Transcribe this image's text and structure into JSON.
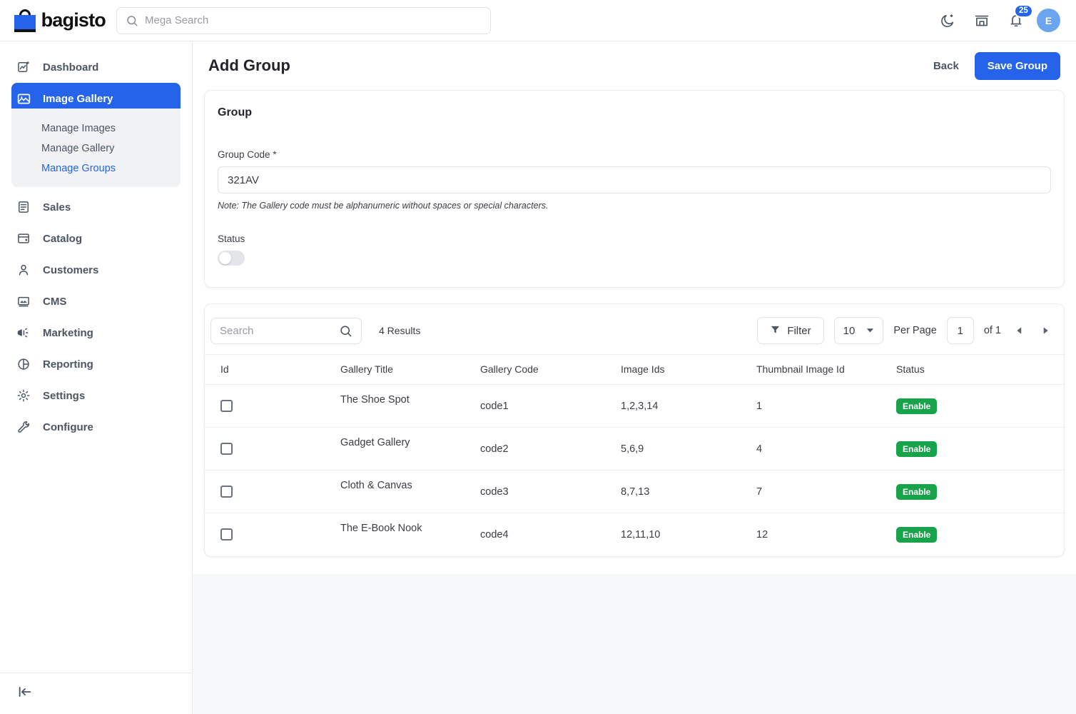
{
  "topbar": {
    "brand_name": "bagisto",
    "search_placeholder": "Mega Search",
    "search_value": "",
    "dark_mode_icon": "moon-icon",
    "store_icon": "storefront-icon",
    "notification_icon": "bell-icon",
    "notification_count": "25",
    "avatar_initial": "E"
  },
  "sidebar": {
    "items": [
      {
        "label": "Dashboard",
        "icon": "dashboard-icon",
        "active": false
      },
      {
        "label": "Image Gallery",
        "icon": "image-gallery-icon",
        "active": true
      },
      {
        "label": "Sales",
        "icon": "sales-icon",
        "active": false
      },
      {
        "label": "Catalog",
        "icon": "catalog-icon",
        "active": false
      },
      {
        "label": "Customers",
        "icon": "customers-icon",
        "active": false
      },
      {
        "label": "CMS",
        "icon": "cms-icon",
        "active": false
      },
      {
        "label": "Marketing",
        "icon": "marketing-icon",
        "active": false
      },
      {
        "label": "Reporting",
        "icon": "reporting-icon",
        "active": false
      },
      {
        "label": "Settings",
        "icon": "settings-gear-icon",
        "active": false
      },
      {
        "label": "Configure",
        "icon": "configure-wrench-icon",
        "active": false
      }
    ],
    "submenu": [
      {
        "label": "Manage Images",
        "current": false
      },
      {
        "label": "Manage Gallery",
        "current": false
      },
      {
        "label": "Manage Groups",
        "current": true
      }
    ],
    "collapse_icon": "collapse-sidebar-icon"
  },
  "page": {
    "title": "Add Group",
    "back_label": "Back",
    "save_label": "Save Group"
  },
  "group_form": {
    "section_title": "Group",
    "group_code_label": "Group Code *",
    "group_code_value": "321AV",
    "group_code_placeholder": "",
    "note": "Note: The Gallery code must be alphanumeric without spaces or special characters.",
    "status_label": "Status",
    "status_on": false
  },
  "grid": {
    "search_placeholder": "Search",
    "search_value": "",
    "results_text": "4 Results",
    "filter_label": "Filter",
    "per_page_value": "10",
    "per_page_label": "Per Page",
    "page_number": "1",
    "of_label": "of 1",
    "prev_icon": "chevron-left-icon",
    "next_icon": "chevron-right-icon",
    "columns": [
      "Id",
      "Gallery Title",
      "Gallery Code",
      "Image Ids",
      "Thumbnail Image Id",
      "Status"
    ],
    "rows": [
      {
        "title": "The Shoe Spot",
        "code": "code1",
        "image_ids": "1,2,3,14",
        "thumbnail_id": "1",
        "status": "Enable"
      },
      {
        "title": "Gadget Gallery",
        "code": "code2",
        "image_ids": "5,6,9",
        "thumbnail_id": "4",
        "status": "Enable"
      },
      {
        "title": "Cloth & Canvas",
        "code": "code3",
        "image_ids": "8,7,13",
        "thumbnail_id": "7",
        "status": "Enable"
      },
      {
        "title": "The E-Book Nook",
        "code": "code4",
        "image_ids": "12,11,10",
        "thumbnail_id": "12",
        "status": "Enable"
      }
    ]
  },
  "colors": {
    "accent": "#2563eb",
    "status_enable": "#16a34a",
    "page_bg": "#f7f8fa",
    "text": "#3c3c46"
  }
}
